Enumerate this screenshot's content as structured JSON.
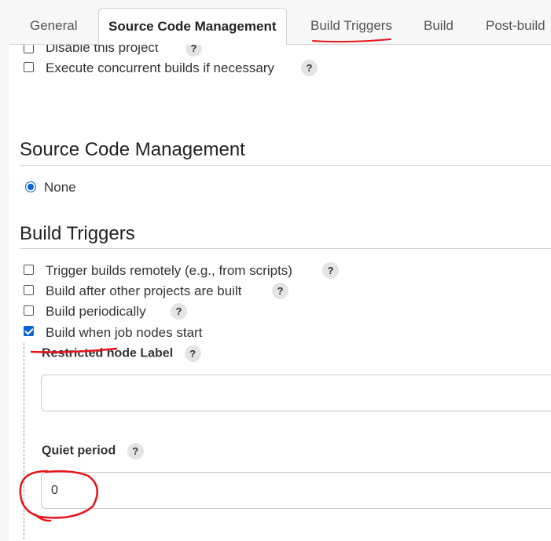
{
  "tabs": [
    {
      "label": "General"
    },
    {
      "label": "Source Code Management",
      "active": true
    },
    {
      "label": "Build Triggers"
    },
    {
      "label": "Build"
    },
    {
      "label": "Post-build"
    }
  ],
  "general": {
    "options": [
      {
        "label": "Disable this project",
        "checked": false
      },
      {
        "label": "Execute concurrent builds if necessary",
        "checked": false
      }
    ]
  },
  "scm": {
    "title": "Source Code Management",
    "radio_label": "None"
  },
  "triggers": {
    "title": "Build Triggers",
    "options": [
      {
        "label": "Trigger builds remotely (e.g., from scripts)",
        "checked": false
      },
      {
        "label": "Build after other projects are built",
        "checked": false
      },
      {
        "label": "Build periodically",
        "checked": false
      },
      {
        "label": "Build when job nodes start",
        "checked": true
      }
    ],
    "restricted_label": "Restricted node Label",
    "restricted_value": "",
    "quiet_label": "Quiet period",
    "quiet_value": "0"
  },
  "help_glyph": "?",
  "colors": {
    "accent": "#0d63d6",
    "annotation": "#e8141c"
  }
}
